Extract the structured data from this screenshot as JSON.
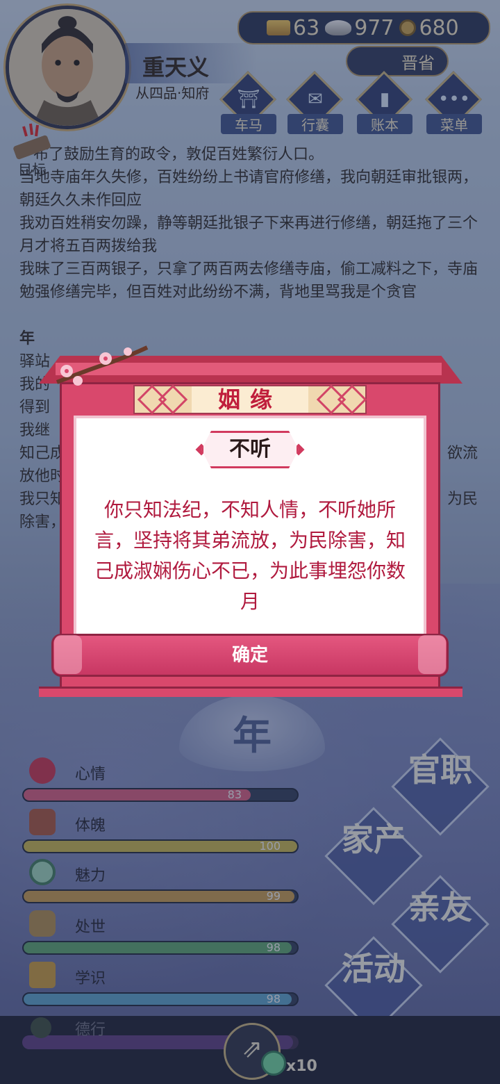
{
  "player": {
    "name": "重天义",
    "rank": "从四品·知府"
  },
  "resources": {
    "gold": "63",
    "silver": "977",
    "coins": "680"
  },
  "promotion_label": "晋省",
  "menu": [
    {
      "label": "车马",
      "icon": "carriage-icon"
    },
    {
      "label": "行囊",
      "icon": "bag-icon"
    },
    {
      "label": "账本",
      "icon": "ledger-icon"
    },
    {
      "label": "菜单",
      "icon": "menu-dots-icon"
    }
  ],
  "goal_label": "目标",
  "story": {
    "line1": "布了鼓励生育的政令，敦促百姓繁衍人口。",
    "line2": "当地寺庙年久失修，百姓纷纷上书请官府修缮，我向朝廷审批银两，朝廷久久未作回应",
    "line3": "我劝百姓稍安勿躁，静等朝廷批银子下来再进行修缮，朝廷拖了三个月才将五百两拨给我",
    "line4": "我昧了三百两银子，只拿了两百两去修缮寺庙，偷工减料之下，寺庙勉强修缮完毕，但百姓对此纷纷不满，背地里骂我是个贪官",
    "year_heading": "年",
    "l5": "驿站",
    "l6": "我的",
    "l7": "得到",
    "l8": "我继",
    "l9a": "知己成",
    "l9b": "欲流",
    "l10": "放他时",
    "l11a": "我只知",
    "l11b": "为民",
    "l12": "除害，"
  },
  "modal": {
    "title": "姻缘",
    "choice": "不听",
    "body": "你只知法纪，不知人情，不听她所言，坚持将其弟流放，为民除害，知己成淑娴伤心不已，为此事埋怨你数月",
    "confirm": "确定"
  },
  "year_emblem": "年",
  "stats": [
    {
      "label": "心情",
      "value": "83",
      "pct": 0.83,
      "color": "#d75a7a",
      "icon": "flower-icon"
    },
    {
      "label": "体魄",
      "value": "100",
      "pct": 1.0,
      "color": "#c9b44a",
      "icon": "drum-icon"
    },
    {
      "label": "魅力",
      "value": "99",
      "pct": 0.99,
      "color": "#c79a4a",
      "icon": "mirror-icon"
    },
    {
      "label": "处世",
      "value": "98",
      "pct": 0.98,
      "color": "#5aa36a",
      "icon": "scroll-icon"
    },
    {
      "label": "学识",
      "value": "98",
      "pct": 0.98,
      "color": "#5aa0c7",
      "icon": "books-icon"
    },
    {
      "label": "德行",
      "value": "",
      "pct": 0.98,
      "color": "#8a5ab0",
      "icon": "virtue-icon"
    }
  ],
  "actions": [
    "官职",
    "家产",
    "亲友",
    "活动"
  ],
  "share_count": "x10"
}
